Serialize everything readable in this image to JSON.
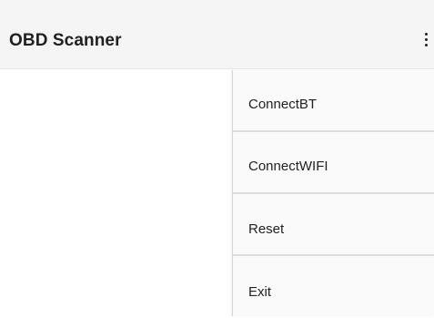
{
  "app_bar": {
    "title": "OBD Scanner",
    "overflow_icon": "more-vert-icon",
    "background": "#f5f5f5"
  },
  "menu": {
    "items": [
      {
        "label": "ConnectBT"
      },
      {
        "label": "ConnectWIFI"
      },
      {
        "label": "Reset"
      },
      {
        "label": "Exit"
      }
    ]
  }
}
